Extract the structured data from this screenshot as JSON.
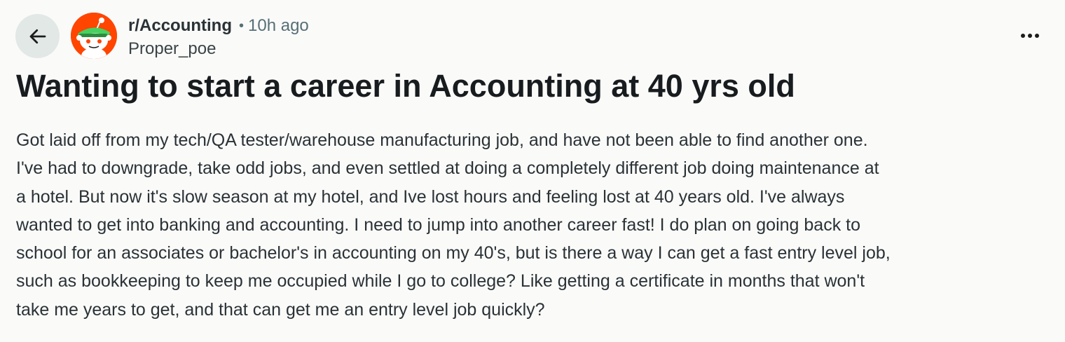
{
  "header": {
    "subreddit": "r/Accounting",
    "separator": "•",
    "time_ago": "10h ago",
    "author": "Proper_poe",
    "back_icon": "arrow-left-icon",
    "more_icon": "more-horizontal-icon"
  },
  "post": {
    "title": "Wanting to start a career in Accounting at 40 yrs old",
    "body_lines": [
      "Got laid off from my tech/QA tester/warehouse manufacturing job, and have not been able to find another one.",
      "I've had to downgrade, take odd jobs, and even settled at doing a completely different job doing maintenance at",
      "a hotel. But now it's slow season at my hotel, and Ive lost hours and feeling lost at 40 years old. I've always",
      "wanted to get into banking and accounting. I need to jump into another career fast! I do plan on going back to",
      "school for an associates or bachelor's in accounting on my 40's, but is there a way I can get a fast entry level job,",
      "such as bookkeeping to keep me occupied while I go to college? Like getting a certificate in months that won't",
      "take me years to get, and that can get me an entry level job quickly?"
    ]
  },
  "colors": {
    "background": "#fafaf9",
    "avatar_bg": "#ff4500",
    "back_button_bg": "#e1e8e5",
    "meta_text": "#576f76"
  }
}
